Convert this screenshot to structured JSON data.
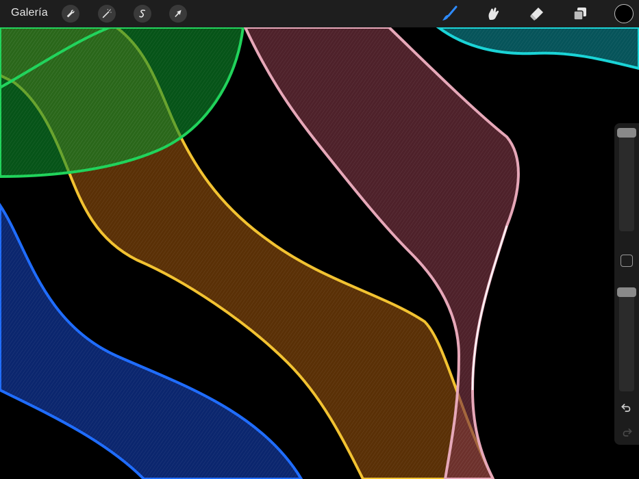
{
  "topbar": {
    "gallery_label": "Galería",
    "left_tools": [
      "wrench-icon",
      "magic-wand-icon",
      "selection-s-icon",
      "transform-arrow-icon"
    ],
    "right_tools": [
      "brush-icon",
      "smudge-icon",
      "eraser-icon",
      "layers-icon"
    ],
    "active_tool": "brush",
    "active_color": "#000000",
    "accent": "#2e8bff"
  },
  "sidebar": {
    "brush_size_level": 0.0,
    "opacity_level": 0.0,
    "buttons": [
      "modify-square",
      "undo-icon",
      "redo-icon"
    ]
  },
  "canvas": {
    "background": "#000000",
    "ribbons": [
      {
        "name": "green",
        "color": "#1fd35a"
      },
      {
        "name": "yellow",
        "color": "#f2c230"
      },
      {
        "name": "pink",
        "color": "#e6a7b8"
      },
      {
        "name": "blue",
        "color": "#1e6cff"
      },
      {
        "name": "cyan",
        "color": "#19d3d6"
      }
    ]
  }
}
